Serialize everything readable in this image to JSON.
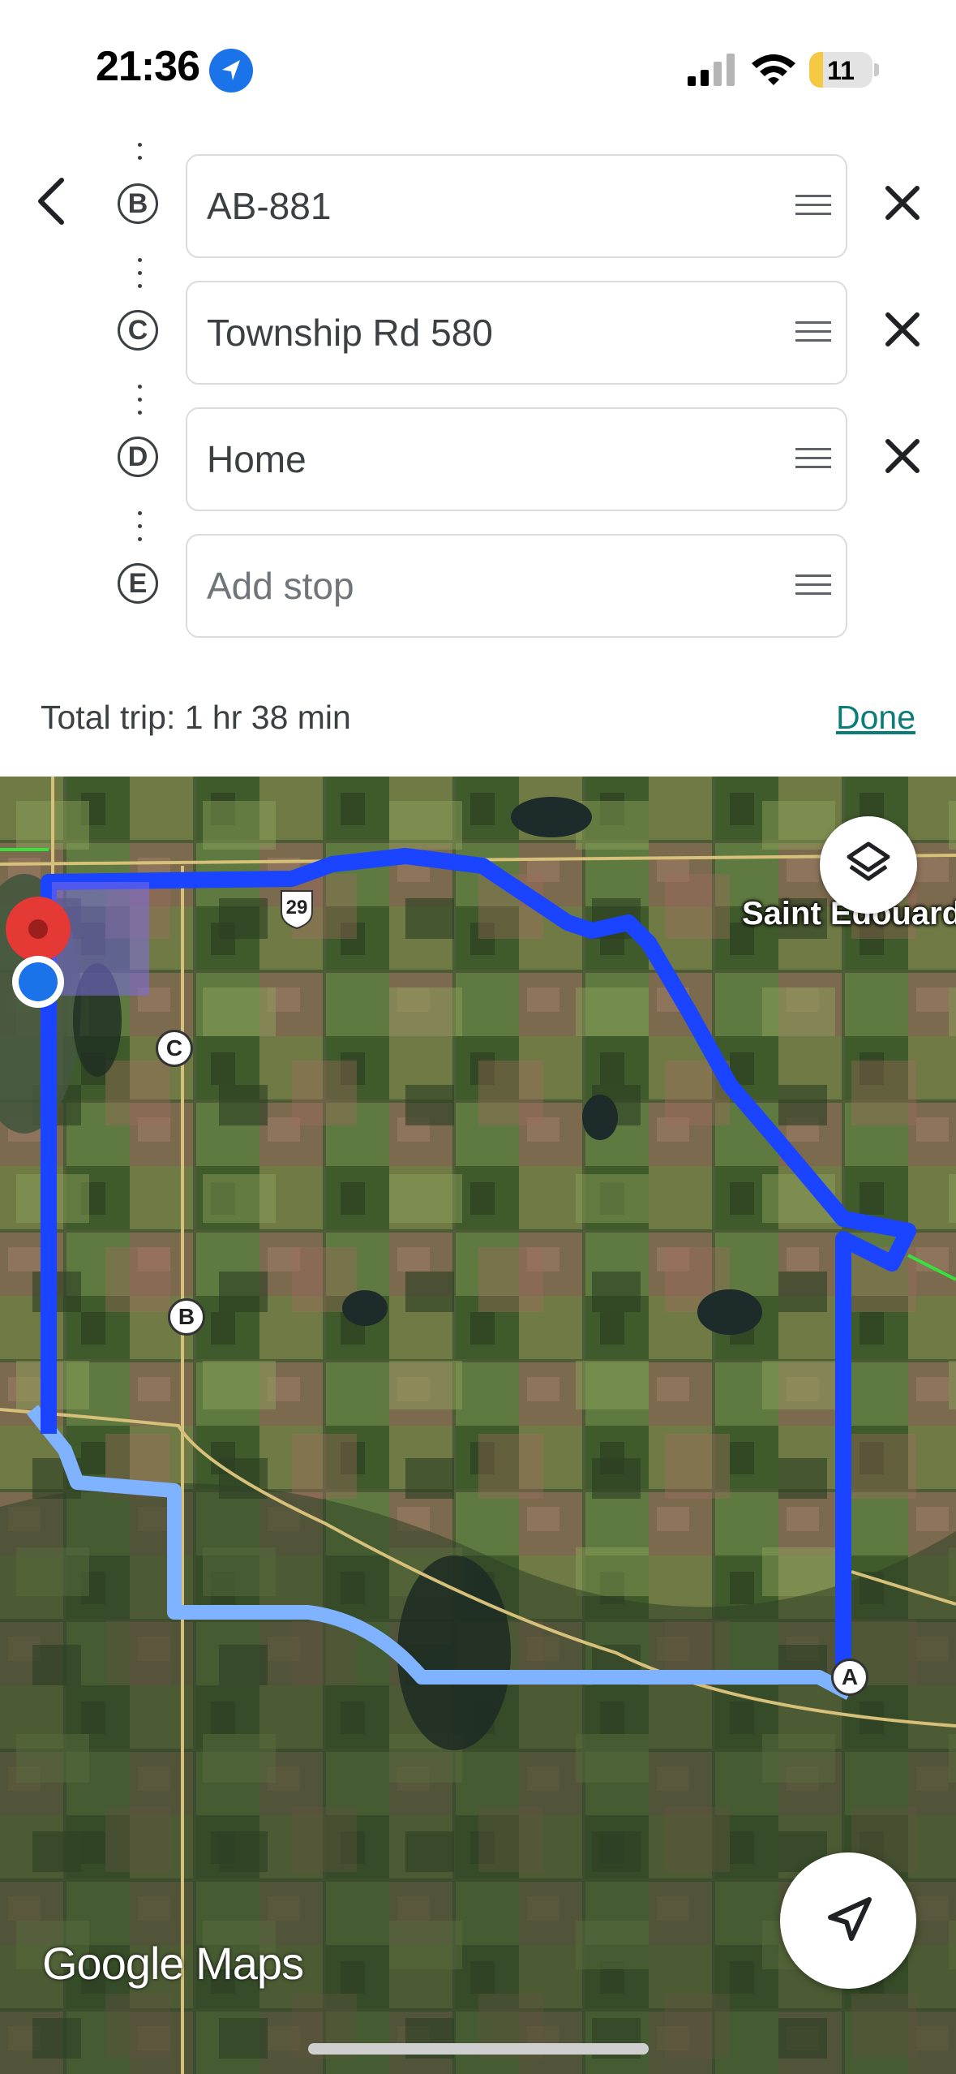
{
  "status": {
    "time": "21:36",
    "battery": "11"
  },
  "stops": [
    {
      "letter": "B",
      "value": "AB-881",
      "placeholder": ""
    },
    {
      "letter": "C",
      "value": "Township Rd 580",
      "placeholder": ""
    },
    {
      "letter": "D",
      "value": "Home",
      "placeholder": ""
    },
    {
      "letter": "E",
      "value": "",
      "placeholder": "Add stop"
    }
  ],
  "trip": {
    "summary": "Total trip: 1 hr 38 min",
    "done_label": "Done"
  },
  "map": {
    "place_label": "Saint Edouard",
    "highway_shield": "29",
    "markers": [
      "A",
      "B",
      "C"
    ],
    "watermark": "Google Maps",
    "route_color": "#1a44ff",
    "alt_route_color": "#7fb2ff"
  }
}
